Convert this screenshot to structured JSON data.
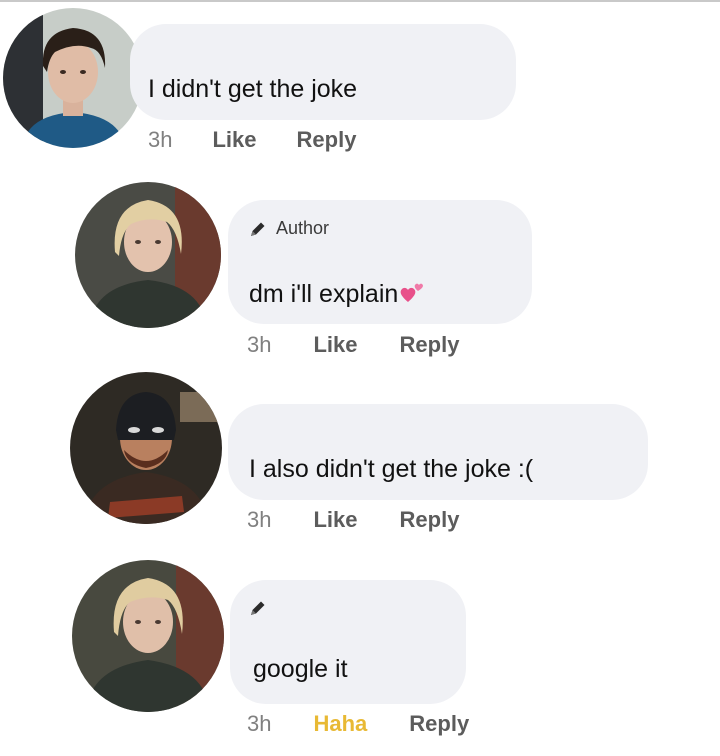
{
  "comments": [
    {
      "avatar_icon": "avatar-dark-haired-man",
      "author_tag": "",
      "text": "I didn't get the joke",
      "time": "3h",
      "reaction": "Like",
      "reply": "Reply"
    },
    {
      "avatar_icon": "avatar-blonde-woman",
      "author_tag": "Author",
      "text": "dm i'll explain",
      "text_icon": "two-hearts-icon",
      "time": "3h",
      "reaction": "Like",
      "reply": "Reply"
    },
    {
      "avatar_icon": "avatar-masked-hero",
      "author_tag": "",
      "text": "I also didn't get the joke :(",
      "time": "3h",
      "reaction": "Like",
      "reply": "Reply"
    },
    {
      "avatar_icon": "avatar-blonde-woman",
      "author_tag": "",
      "tag_icon": "pencil-icon",
      "text": "google it",
      "time": "3h",
      "reaction": "Haha",
      "reaction_color": "#e8b934",
      "reply": "Reply"
    }
  ],
  "colors": {
    "bubble": "#f0f1f5",
    "action_text": "#5c5c5c",
    "time_text": "#808080",
    "heart": "#e8508a"
  }
}
